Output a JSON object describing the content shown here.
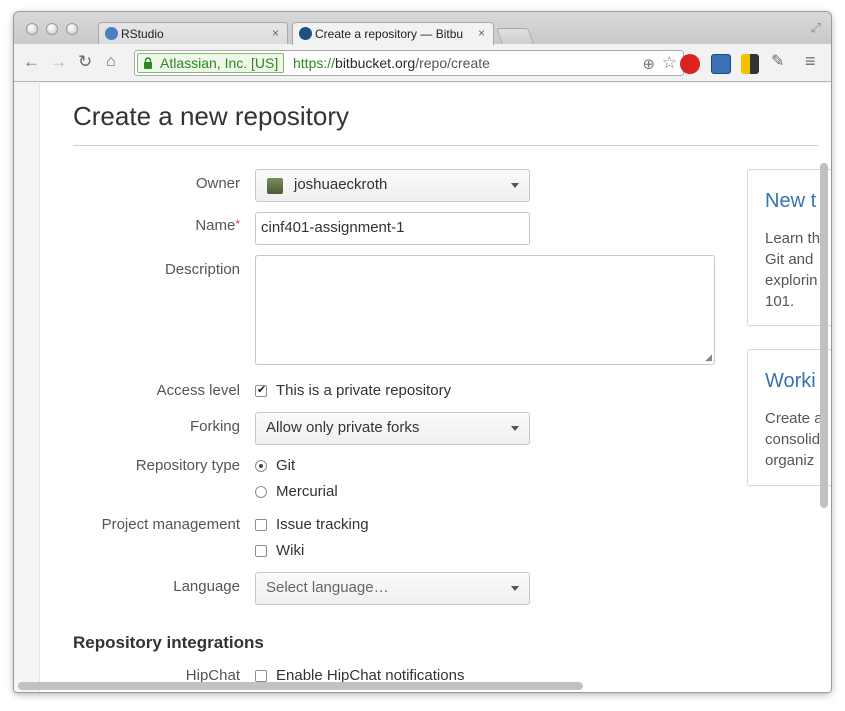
{
  "browser": {
    "tabs": [
      {
        "label": "RStudio"
      },
      {
        "label": "Create a repository — Bitbu"
      }
    ],
    "close_glyph": "×",
    "security_badge": "Atlassian, Inc. [US]",
    "url": {
      "scheme": "https://",
      "host": "bitbucket.org",
      "path": "/repo/create"
    },
    "icons": [
      "back-arrow-icon",
      "forward-arrow-icon",
      "reload-icon",
      "home-icon",
      "lock-icon",
      "zoom-icon",
      "star-icon",
      "menu-icon"
    ]
  },
  "page": {
    "title": "Create a new repository",
    "form": {
      "owner_label": "Owner",
      "owner_value": "joshuaeckroth",
      "name_label": "Name",
      "name_required": "*",
      "name_value": "cinf401-assignment-1",
      "description_label": "Description",
      "description_value": "",
      "access_label": "Access level",
      "access_option": "This is a private repository",
      "access_checked": true,
      "forking_label": "Forking",
      "forking_value": "Allow only private forks",
      "repo_type_label": "Repository type",
      "repo_type_options": [
        "Git",
        "Mercurial"
      ],
      "repo_type_selected": "Git",
      "pm_label": "Project management",
      "pm_options": [
        "Issue tracking",
        "Wiki"
      ],
      "language_label": "Language",
      "language_placeholder": "Select language…"
    },
    "integrations": {
      "heading": "Repository integrations",
      "hipchat_label": "HipChat",
      "hipchat_option": "Enable HipChat notifications"
    },
    "side_cards": [
      {
        "title": "New t",
        "text": "Learn th\nGit and\nexplorin\n101."
      },
      {
        "title": "Worki",
        "text": "Create a\nconsolid\norganiz"
      }
    ]
  }
}
